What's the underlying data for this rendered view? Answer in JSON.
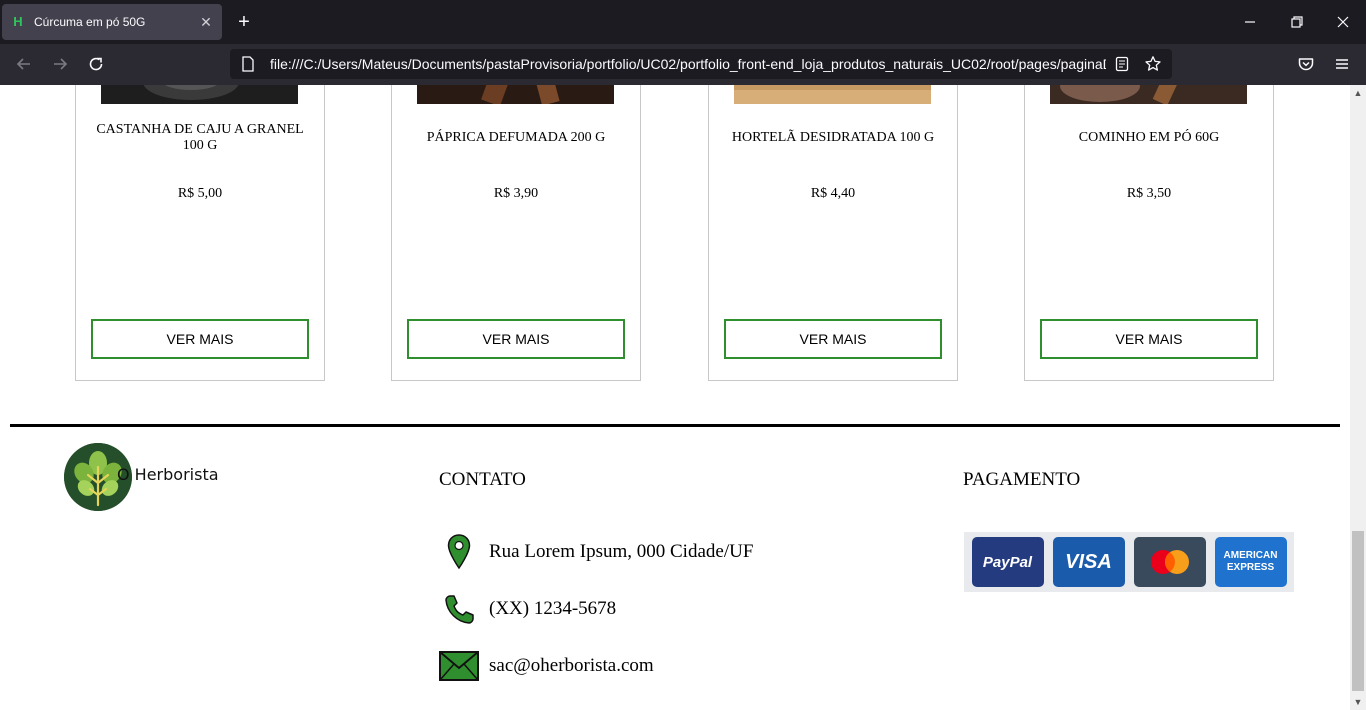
{
  "browser": {
    "tab_title": "Cúrcuma em pó 50G",
    "favicon_glyph": "H",
    "new_tab_glyph": "+",
    "close_tab_glyph": "✕",
    "url": "file:///C:/Users/Mateus/Documents/pastaProvisoria/portfolio/UC02/portfolio_front-end_loja_produtos_naturais_UC02/root/pages/paginaDe"
  },
  "products": [
    {
      "name": "CASTANHA DE CAJU A GRANEL 100 G",
      "price": "R$ 5,00",
      "button": "VER MAIS",
      "photo_color": "#1e1e1e"
    },
    {
      "name": "PÁPRICA DEFUMADA 200 G",
      "price": "R$ 3,90",
      "button": "VER MAIS",
      "photo_color": "#2a1a14"
    },
    {
      "name": "HORTELÃ DESIDRATADA 100 G",
      "price": "R$ 4,40",
      "button": "VER MAIS",
      "photo_color": "#c79a63"
    },
    {
      "name": "COMINHO EM PÓ 60G",
      "price": "R$ 3,50",
      "button": "VER MAIS",
      "photo_color": "#5a3a2c"
    }
  ],
  "footer": {
    "brand": "O Herborista",
    "contact_heading": "CONTATO",
    "address": "Rua Lorem Ipsum, 000 Cidade/UF",
    "phone": "(XX) 1234-5678",
    "email": "sac@oherborista.com",
    "payment_heading": "PAGAMENTO",
    "payment_methods": [
      "PayPal",
      "VISA",
      "Mastercard",
      "AMERICAN EXPRESS"
    ]
  },
  "colors": {
    "accent_green": "#2f8f2f",
    "logo_dark_green": "#244f2a",
    "chrome_dark": "#1c1b22",
    "paypal_blue": "#253b80",
    "visa_blue": "#1a5bab",
    "mastercard_bg": "#384a5c",
    "amex_blue": "#1f72cd"
  }
}
